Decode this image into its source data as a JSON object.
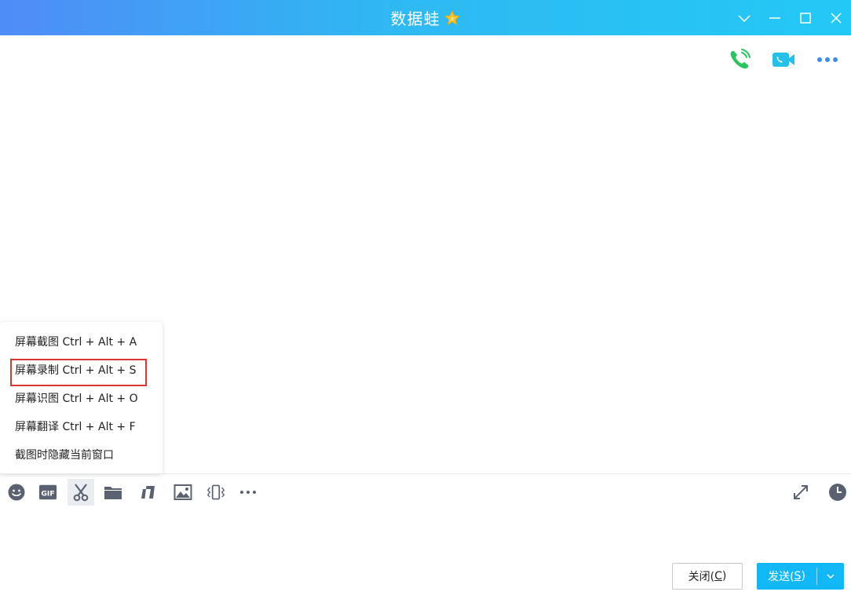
{
  "window": {
    "title": "数据蛙",
    "controls": [
      "chevron-down-icon",
      "minimize-icon",
      "maximize-icon",
      "close-icon"
    ]
  },
  "call_tools": [
    "voice-call-icon",
    "video-call-icon",
    "more-icon"
  ],
  "popup_menu": {
    "items": [
      {
        "label": "屏幕截图 Ctrl + Alt + A"
      },
      {
        "label": "屏幕录制 Ctrl + Alt + S",
        "highlighted": true
      },
      {
        "label": "屏幕识图 Ctrl + Alt + O"
      },
      {
        "label": "屏幕翻译 Ctrl + Alt + F"
      },
      {
        "label": "截图时隐藏当前窗口"
      }
    ]
  },
  "toolbar": {
    "items": [
      "emoji-icon",
      "gif-icon",
      "scissors-icon",
      "folder-icon",
      "music-icon",
      "image-icon",
      "shake-icon",
      "more-icon"
    ],
    "right": [
      "expand-icon",
      "clock-icon"
    ]
  },
  "buttons": {
    "close_label": "关闭(",
    "close_key": "C",
    "close_suffix": ")",
    "send_label": "发送(",
    "send_key": "S",
    "send_suffix": ")"
  },
  "colors": {
    "accent": "#12b7f5",
    "title_gradient_start": "#4f8cf7",
    "title_gradient_end": "#23c9f6",
    "highlight_border": "#d9362f",
    "icon_gray": "#5a6170",
    "call_green": "#2ec360",
    "video_blue": "#25c0e8"
  }
}
